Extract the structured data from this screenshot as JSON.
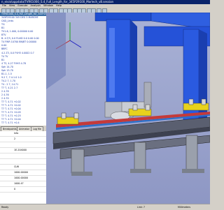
{
  "window": {
    "title": "n_eivio\\appdata\\TVR61000_S.4_Full_Length_for_345P29100_Marlech_v8.session"
  },
  "menu": [
    "File",
    "View",
    "Execute",
    "Analysis",
    "Window",
    "Help"
  ],
  "tree": {
    "rows": [
      "TVR61000_S.4_Full_Length_for_345P29",
      "345P29100 345 DEG 5 MARCHE",
      "CAD_Links",
      "Ti1",
      "B1",
      "TV1-6, 1.000, 0.00000 0.00",
      "BTV",
      "B- 4-T/3, 0.0 FLUID 0.0 0.00 0.00",
      "T4 FWR 10700 BN/BT 0.00000",
      "0.00",
      "BBFC",
      "4-2 Z3, 0.0 FVH3 4.0002 0.7",
      "T4 TV",
      "B1",
      "4 T3, 4-27 FVH3 4.78",
      "Sph 14-70",
      "Sph 13-70",
      "B1-1, 1.5",
      "9-2 7, 7.4-1.0 1.0",
      "T4-2 7, 1.70",
      "T4 - 2 7, 14.71",
      "T7 T, 4-21 2-7",
      "2 4-78",
      "2 4-76",
      "2 4-70",
      "T7 T- 4-71 +0.02",
      "T7 T- 4-71 +0.02",
      "T7 T- 4-71 +0.04",
      "T7 T- 4-71 +0.05",
      "T7 T- 4-71 +0.25",
      "T7 T- 4-71 +0.04",
      "T7 T- 4-71 +0.4"
    ]
  },
  "tabs": [
    "Breakpoints",
    "Animator",
    "Log file"
  ],
  "properties": {
    "rows": [
      "Info",
      "2",
      "",
      "1E-204000",
      "",
      "",
      "CLW",
      "1000.00000",
      "1000.00000",
      "1000.47",
      "0"
    ]
  },
  "status": {
    "left": "Ready",
    "center": "Link: 7",
    "right": "Millimeters"
  }
}
